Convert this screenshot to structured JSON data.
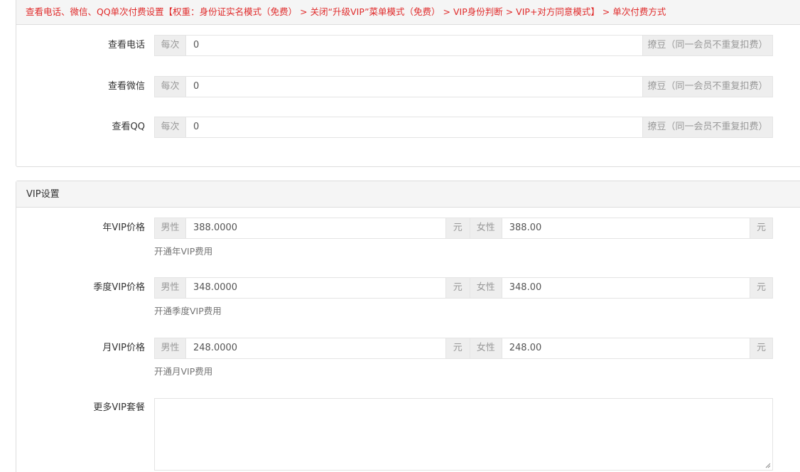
{
  "pay_panel": {
    "heading": "查看电话、微信、QQ单次付费设置【权重：身份证实名模式（免费） > 关闭“升级VIP”菜单模式（免费） > VIP身份判断 > VIP+对方同意模式】 > 单次付费方式",
    "rows": [
      {
        "label": "查看电话",
        "prefix": "每次",
        "value": "0",
        "suffix": "撩豆（同一会员不重复扣费）"
      },
      {
        "label": "查看微信",
        "prefix": "每次",
        "value": "0",
        "suffix": "撩豆（同一会员不重复扣费）"
      },
      {
        "label": "查看QQ",
        "prefix": "每次",
        "value": "0",
        "suffix": "撩豆（同一会员不重复扣费）"
      }
    ]
  },
  "vip_panel": {
    "heading": "VIP设置",
    "rows": [
      {
        "label": "年VIP价格",
        "male_prefix": "男性",
        "male_value": "388.0000",
        "unit": "元",
        "female_prefix": "女性",
        "female_value": "388.00",
        "help": "开通年VIP费用"
      },
      {
        "label": "季度VIP价格",
        "male_prefix": "男性",
        "male_value": "348.0000",
        "unit": "元",
        "female_prefix": "女性",
        "female_value": "348.00",
        "help": "开通季度VIP费用"
      },
      {
        "label": "月VIP价格",
        "male_prefix": "男性",
        "male_value": "248.0000",
        "unit": "元",
        "female_prefix": "女性",
        "female_value": "248.00",
        "help": "开通月VIP费用"
      }
    ],
    "more": {
      "label": "更多VIP套餐",
      "value": ""
    }
  }
}
